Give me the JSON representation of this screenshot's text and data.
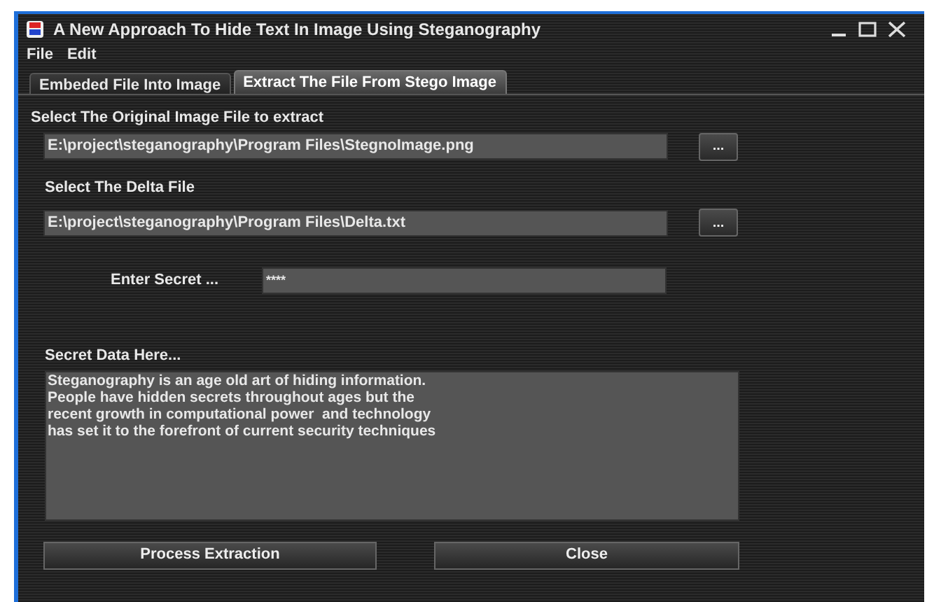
{
  "window": {
    "title": "A New Approach To Hide Text In Image Using Steganography"
  },
  "menu": [
    "File",
    "Edit"
  ],
  "tabs": [
    {
      "label": "Embeded File Into Image",
      "selected": false
    },
    {
      "label": "Extract The File From Stego Image",
      "selected": true
    }
  ],
  "image_file": {
    "label": "Select The Original Image File to extract",
    "value": "E:\\project\\steganography\\Program Files\\StegnoImage.png",
    "browse": "..."
  },
  "delta_file": {
    "label": "Select The Delta File",
    "value": "E:\\project\\steganography\\Program Files\\Delta.txt",
    "browse": "..."
  },
  "secret": {
    "label": "Enter Secret ...",
    "value": "****"
  },
  "secret_data": {
    "label": "Secret Data Here...",
    "value": "Steganography is an age old art of hiding information.\nPeople have hidden secrets throughout ages but the\nrecent growth in computational power  and technology\nhas set it to the forefront of current security techniques"
  },
  "buttons": [
    "Process Extraction",
    "Close"
  ]
}
